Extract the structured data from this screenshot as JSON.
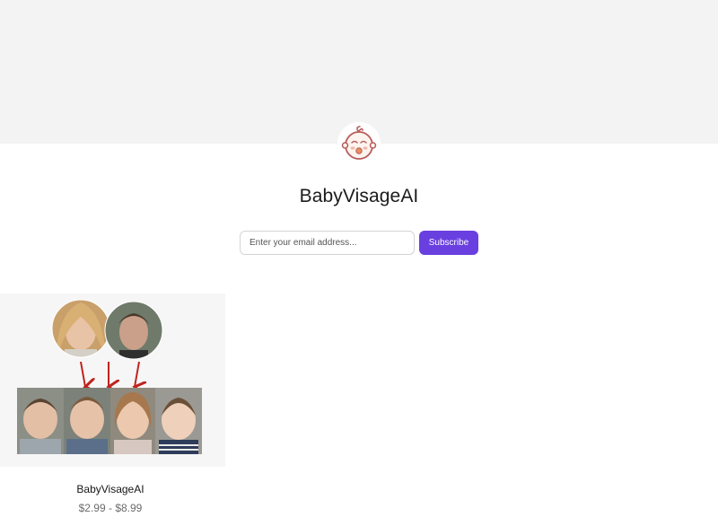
{
  "shop": {
    "name": "BabyVisageAI",
    "avatar_icon": "baby-face-icon"
  },
  "subscribe": {
    "placeholder": "Enter your email address...",
    "button_label": "Subscribe",
    "accent_color": "#6a3fe0"
  },
  "products": [
    {
      "name": "BabyVisageAI",
      "price": "$2.99 - $8.99",
      "image_icon": "parents-to-babies-illustration"
    }
  ]
}
